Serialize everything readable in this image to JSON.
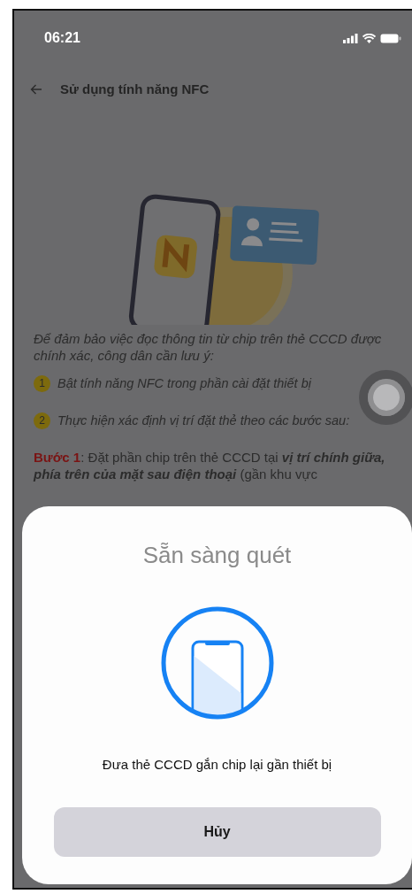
{
  "status_bar": {
    "time": "06:21"
  },
  "header": {
    "title": "Sử dụng tính năng NFC"
  },
  "intro": "Để đảm bảo việc đọc thông tin từ chip trên thẻ CCCD được chính xác, công dân cần lưu ý:",
  "notes": [
    {
      "number": "1",
      "text": "Bật tính năng NFC trong phần cài đặt thiết bị"
    },
    {
      "number": "2",
      "text": "Thực hiện xác định vị trí đặt thẻ theo các bước sau:"
    }
  ],
  "step": "**Bước 1**: Đặt phần chip trên thẻ CCCD tại **vị trí chính giữa, phía trên của mặt sau điện thoại** (gần khu vực",
  "scan_sheet": {
    "title": "Sẵn sàng quét",
    "message": "Đưa thẻ CCCD gắn chip lại gần thiết bị",
    "cancel_button": "Hủy"
  }
}
